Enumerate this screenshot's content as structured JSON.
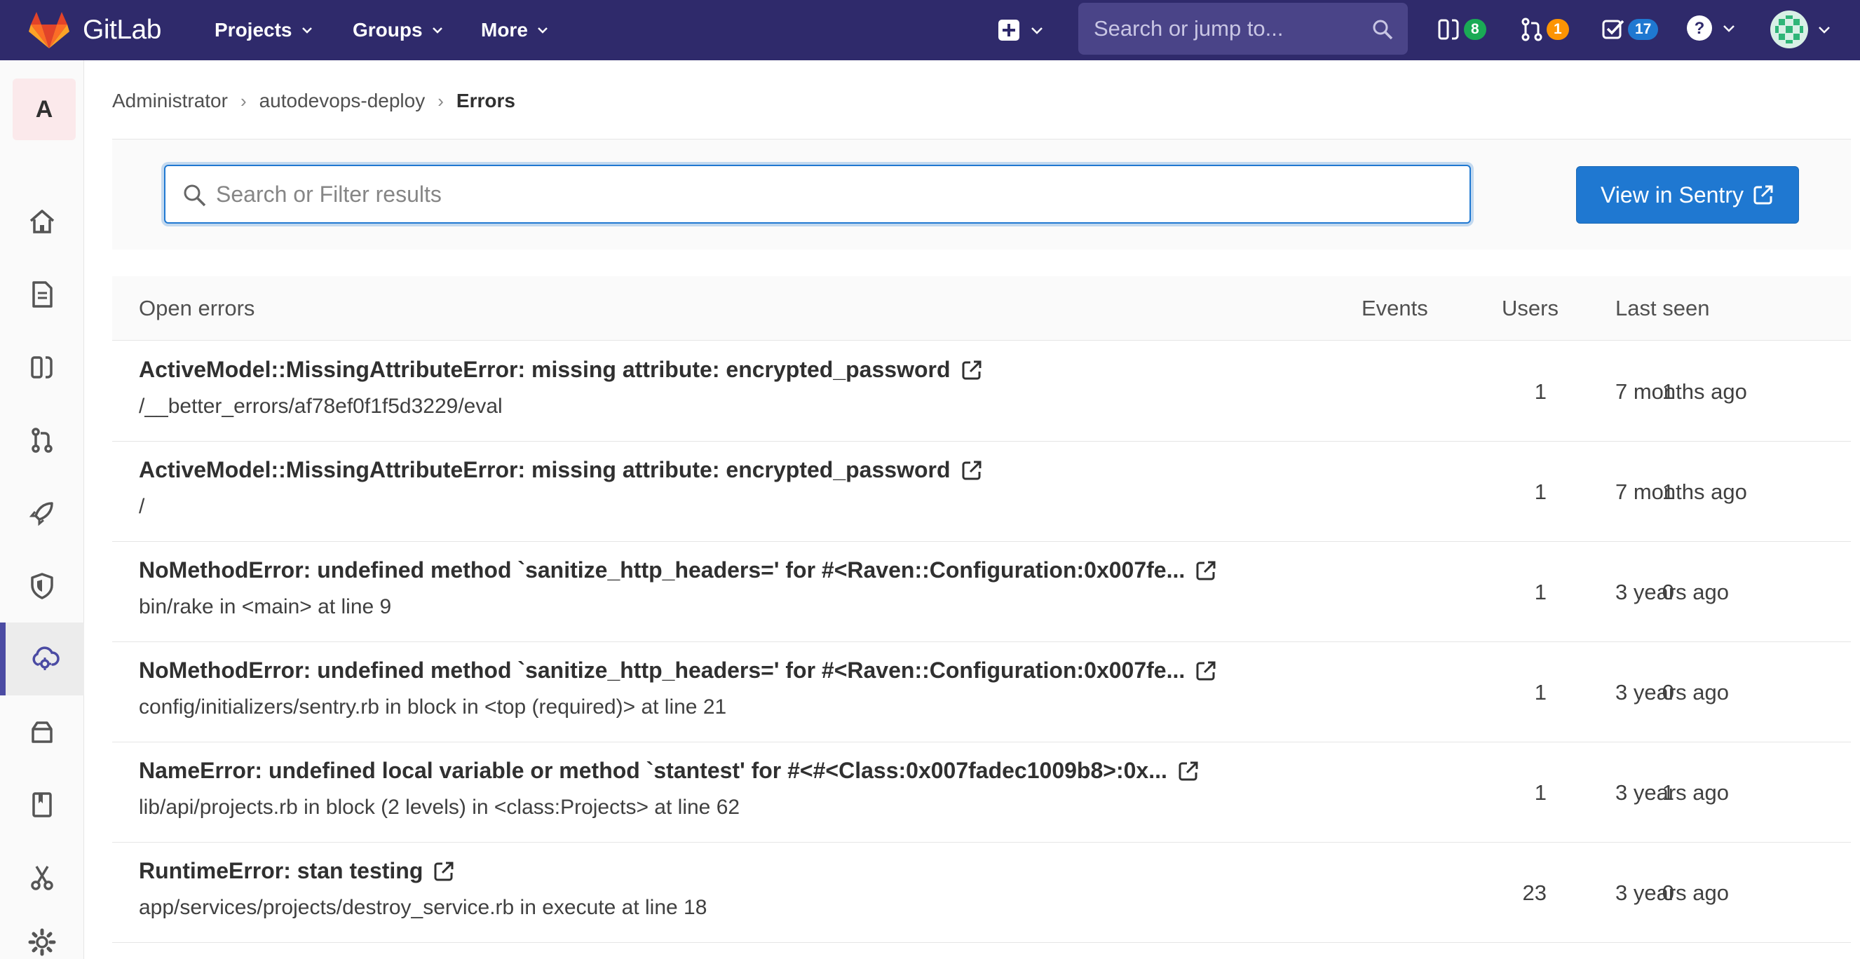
{
  "navbar": {
    "brand": "GitLab",
    "menus": [
      {
        "label": "Projects"
      },
      {
        "label": "Groups"
      },
      {
        "label": "More"
      }
    ],
    "search_placeholder": "Search or jump to...",
    "issues_count": "8",
    "merge_requests_count": "1",
    "todos_count": "17",
    "badge_colors": {
      "issues": "#1aaa55",
      "merge_requests": "#fc9403",
      "todos": "#1f78d1"
    },
    "background_color": "#2f2a6b"
  },
  "sidebar": {
    "project_letter": "A",
    "items": [
      {
        "icon": "home-icon"
      },
      {
        "icon": "repository-icon"
      },
      {
        "icon": "issues-icon"
      },
      {
        "icon": "merge-request-icon"
      },
      {
        "icon": "rocket-icon"
      },
      {
        "icon": "shield-icon"
      },
      {
        "icon": "cloud-gear-icon",
        "active": true
      },
      {
        "icon": "package-icon"
      },
      {
        "icon": "book-icon"
      },
      {
        "icon": "snippets-scissors-icon"
      },
      {
        "icon": "settings-gear-icon"
      }
    ]
  },
  "breadcrumb": {
    "items": [
      "Administrator",
      "autodevops-deploy"
    ],
    "current": "Errors"
  },
  "filter": {
    "placeholder": "Search or Filter results",
    "sentry_button": "View in Sentry"
  },
  "table": {
    "headers": {
      "title": "Open errors",
      "events": "Events",
      "users": "Users",
      "last_seen": "Last seen"
    },
    "rows": [
      {
        "title": "ActiveModel::MissingAttributeError: missing attribute: encrypted_password",
        "culprit": "/__better_errors/af78ef0f1f5d3229/eval",
        "events": "1",
        "users": "1",
        "last_seen": "7 months ago"
      },
      {
        "title": "ActiveModel::MissingAttributeError: missing attribute: encrypted_password",
        "culprit": "/",
        "events": "1",
        "users": "1",
        "last_seen": "7 months ago"
      },
      {
        "title": "NoMethodError: undefined method `sanitize_http_headers=' for #<Raven::Configuration:0x007fe...",
        "culprit": "bin/rake in <main> at line 9",
        "events": "1",
        "users": "0",
        "last_seen": "3 years ago"
      },
      {
        "title": "NoMethodError: undefined method `sanitize_http_headers=' for #<Raven::Configuration:0x007fe...",
        "culprit": "config/initializers/sentry.rb in block in <top (required)> at line 21",
        "events": "1",
        "users": "0",
        "last_seen": "3 years ago"
      },
      {
        "title": "NameError: undefined local variable or method `stantest' for #<#<Class:0x007fadec1009b8>:0x...",
        "culprit": "lib/api/projects.rb in block (2 levels) in <class:Projects> at line 62",
        "events": "1",
        "users": "1",
        "last_seen": "3 years ago"
      },
      {
        "title": "RuntimeError: stan testing",
        "culprit": "app/services/projects/destroy_service.rb in execute at line 18",
        "events": "23",
        "users": "0",
        "last_seen": "3 years ago"
      }
    ]
  },
  "colors": {
    "accent": "#1f78d1",
    "active_sidebar": "#4b4ba3"
  }
}
